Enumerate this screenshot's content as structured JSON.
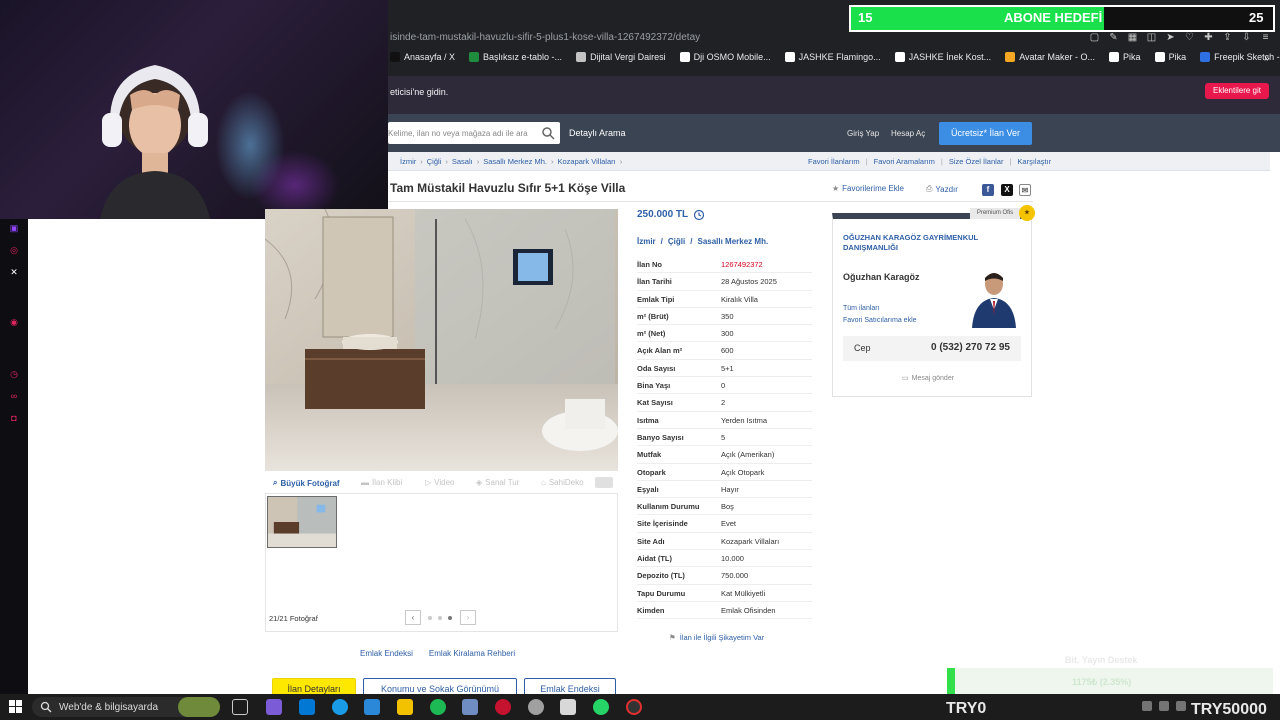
{
  "browser": {
    "url": "isinde-tam-mustakil-havuzlu-sifir-5-plus1-kose-villa-1267492372/detay",
    "bookmarks": [
      {
        "label": "Anasayfa / X",
        "color": "#111111"
      },
      {
        "label": "Başlıksız e-tablo -...",
        "color": "#1e8e3e"
      },
      {
        "label": "Dijital Vergi Dairesi",
        "color": "#c3c3c3"
      },
      {
        "label": "Dji OSMO Mobile...",
        "color": "#ffffff"
      },
      {
        "label": "JASHKE Flamingo...",
        "color": "#ffffff"
      },
      {
        "label": "JASHKE İnek Kost...",
        "color": "#ffffff"
      },
      {
        "label": "Avatar Maker - O...",
        "color": "#f5a623"
      },
      {
        "label": "Pika",
        "color": "#ffffff"
      },
      {
        "label": "Pika",
        "color": "#ffffff"
      },
      {
        "label": "Freepik Sketch - F...",
        "color": "#2f6fe4"
      }
    ],
    "notice_text": "eticisi'ne gidin.",
    "notice_button": "Eklentilere git"
  },
  "header": {
    "search_placeholder": "Kelime, ilan no veya mağaza adı ile ara",
    "detailed_search": "Detaylı Arama",
    "login": "Giriş Yap",
    "register": "Hesap Aç",
    "post_ad": "Ücretsiz* İlan Ver"
  },
  "breadcrumb": [
    "İzmir",
    "Çiğli",
    "Sasalı",
    "Sasallı Merkez Mh.",
    "Kozapark Villaları"
  ],
  "breadcrumb_right": [
    "Favori İlanlarım",
    "Favori Aramalarım",
    "Size Özel İlanlar",
    "Karşılaştır"
  ],
  "listing": {
    "title": "Tam Müstakil Havuzlu Sıfır 5+1 Köşe Villa",
    "add_favorite": "Favorilerime Ekle",
    "print": "Yazdır",
    "price": "250.000 TL",
    "location": [
      "İzmir",
      "Çiğli",
      "Sasallı Merkez Mh."
    ],
    "info": [
      {
        "k": "İlan No",
        "v": "1267492372",
        "red": true
      },
      {
        "k": "İlan Tarihi",
        "v": "28 Ağustos 2025"
      },
      {
        "k": "Emlak Tipi",
        "v": "Kiralık Villa"
      },
      {
        "k": "m² (Brüt)",
        "v": "350"
      },
      {
        "k": "m² (Net)",
        "v": "300"
      },
      {
        "k": "Açık Alan m²",
        "v": "600"
      },
      {
        "k": "Oda Sayısı",
        "v": "5+1"
      },
      {
        "k": "Bina Yaşı",
        "v": "0"
      },
      {
        "k": "Kat Sayısı",
        "v": "2"
      },
      {
        "k": "Isıtma",
        "v": "Yerden Isıtma"
      },
      {
        "k": "Banyo Sayısı",
        "v": "5"
      },
      {
        "k": "Mutfak",
        "v": "Açık (Amerikan)"
      },
      {
        "k": "Otopark",
        "v": "Açık Otopark"
      },
      {
        "k": "Eşyalı",
        "v": "Hayır"
      },
      {
        "k": "Kullanım Durumu",
        "v": "Boş"
      },
      {
        "k": "Site İçerisinde",
        "v": "Evet"
      },
      {
        "k": "Site Adı",
        "v": "Kozapark Villaları"
      },
      {
        "k": "Aidat (TL)",
        "v": "10.000"
      },
      {
        "k": "Depozito (TL)",
        "v": "750.000"
      },
      {
        "k": "Tapu Durumu",
        "v": "Kat Mülkiyetli"
      },
      {
        "k": "Kimden",
        "v": "Emlak Ofisinden"
      }
    ],
    "report": "İlan ile İlgili Şikayetim Var"
  },
  "gallery": {
    "tabs": [
      "Büyük Fotoğraf",
      "İlan Klibi",
      "Video",
      "Sanal Tur",
      "SahiDeko"
    ],
    "count": "21/21 Fotoğraf"
  },
  "seller": {
    "badge": "Premium Ofis",
    "agency": "OĞUZHAN KARAGÖZ GAYRİMENKUL DANIŞMANLIĞI",
    "agent": "Oğuzhan Karagöz",
    "all_listings": "Tüm ilanları",
    "fav_sellers": "Favori Satıcılarıma ekle",
    "phone_label": "Cep",
    "phone": "0 (532) 270 72 95",
    "message": "Mesaj gönder"
  },
  "footer": {
    "links": [
      "Emlak Endeksi",
      "Emlak Kiralama Rehberi"
    ],
    "tabs": [
      "İlan Detayları",
      "Konumu ve Sokak Görünümü",
      "Emlak Endeksi"
    ]
  },
  "stream": {
    "goal_start": "15",
    "goal_title": "ABONE HEDEFİ",
    "goal_end": "25",
    "goal_progress": 0.6,
    "donation_label": "Bit. Yayın Destek",
    "donation_amount": "1175₺ (2.35%)",
    "counter_left": "TRY0",
    "counter_right": "TRY50000"
  },
  "taskbar": {
    "search_text": "Web'de & bilgisayarda"
  }
}
